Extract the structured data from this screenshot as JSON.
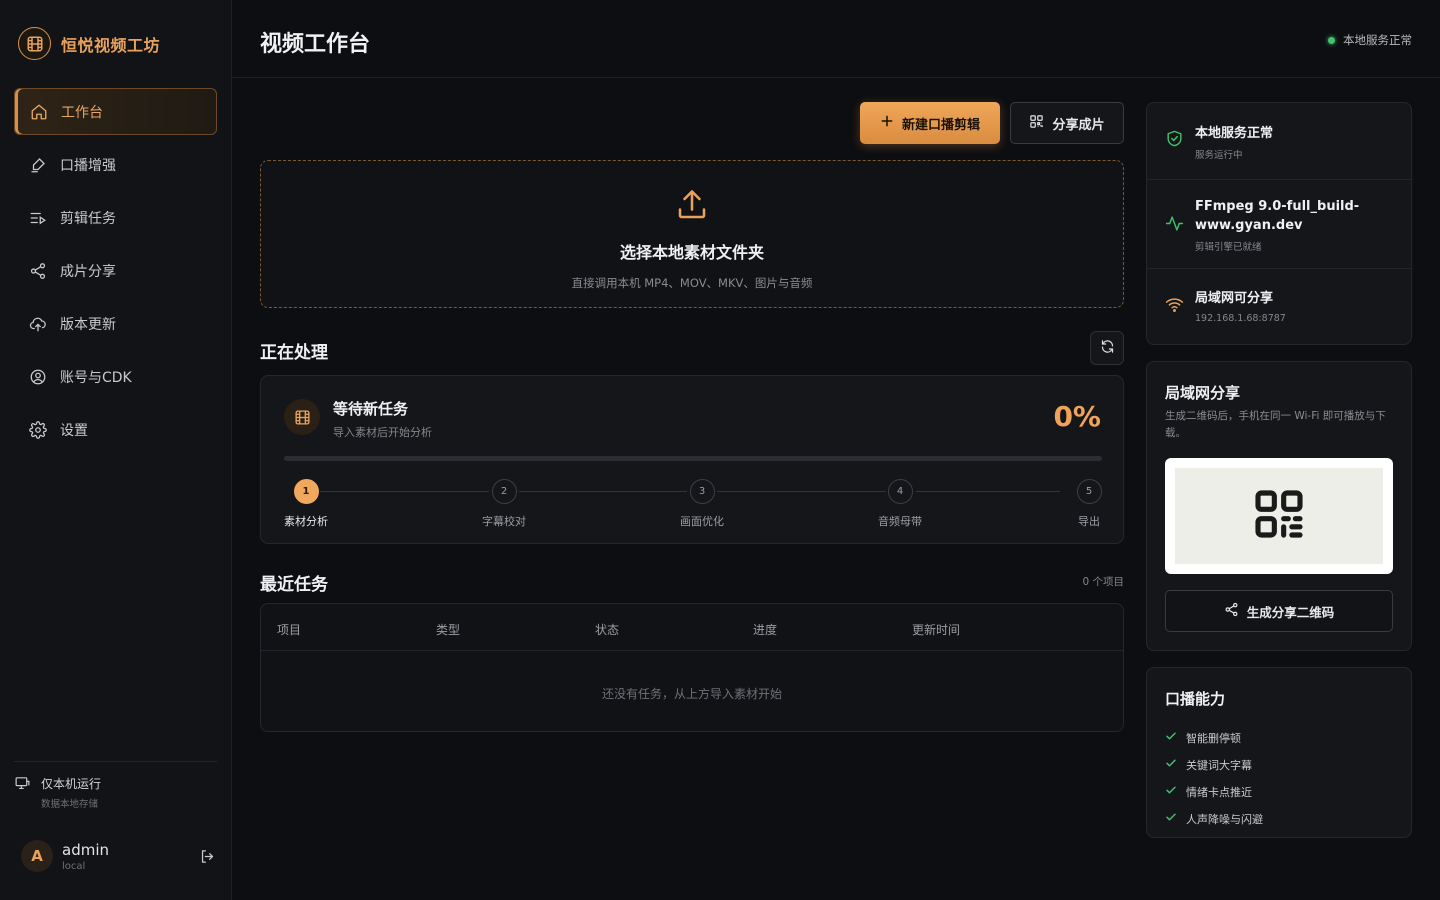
{
  "brand": {
    "name": "恒悦视频工坊"
  },
  "sidebar": {
    "items": [
      {
        "label": "工作台",
        "icon": "home-icon",
        "active": true
      },
      {
        "label": "口播增强",
        "icon": "brush-icon",
        "active": false
      },
      {
        "label": "剪辑任务",
        "icon": "task-list-icon",
        "active": false
      },
      {
        "label": "成片分享",
        "icon": "share-icon",
        "active": false
      },
      {
        "label": "版本更新",
        "icon": "cloud-update-icon",
        "active": false
      },
      {
        "label": "账号与CDK",
        "icon": "user-circle-icon",
        "active": false
      },
      {
        "label": "设置",
        "icon": "gear-icon",
        "active": false
      }
    ],
    "local": {
      "title": "仅本机运行",
      "subtitle": "数据本地存储"
    },
    "user": {
      "avatar": "A",
      "name": "admin",
      "role": "local"
    }
  },
  "header": {
    "title": "视频工作台",
    "status": "本地服务正常"
  },
  "toolbar": {
    "new_label": "新建口播剪辑",
    "share_label": "分享成片"
  },
  "dropzone": {
    "title": "选择本地素材文件夹",
    "subtitle": "直接调用本机 MP4、MOV、MKV、图片与音频"
  },
  "processing": {
    "section_title": "正在处理",
    "task_title": "等待新任务",
    "task_subtitle": "导入素材后开始分析",
    "percent_label": "0%",
    "progress": 0,
    "steps": [
      {
        "num": "1",
        "label": "素材分析",
        "active": true
      },
      {
        "num": "2",
        "label": "字幕校对",
        "active": false
      },
      {
        "num": "3",
        "label": "画面优化",
        "active": false
      },
      {
        "num": "4",
        "label": "音频母带",
        "active": false
      },
      {
        "num": "5",
        "label": "导出",
        "active": false
      }
    ]
  },
  "recent": {
    "section_title": "最近任务",
    "count_label": "0 个项目",
    "columns": [
      "项目",
      "类型",
      "状态",
      "进度",
      "更新时间"
    ],
    "empty_message": "还没有任务，从上方导入素材开始"
  },
  "services": [
    {
      "title": "本地服务正常",
      "subtitle": "服务运行中",
      "icon": "shield-check-icon"
    },
    {
      "title": "FFmpeg 9.0-full_build-www.gyan.dev",
      "subtitle": "剪辑引擎已就绪",
      "icon": "pulse-icon"
    },
    {
      "title": "局域网可分享",
      "subtitle": "192.168.1.68:8787",
      "icon": "wifi-icon"
    }
  ],
  "lan_share": {
    "title": "局域网分享",
    "description": "生成二维码后，手机在同一 Wi-Fi 即可播放与下载。",
    "button_label": "生成分享二维码"
  },
  "capabilities": {
    "title": "口播能力",
    "items": [
      "智能删停顿",
      "关键词大字幕",
      "情绪卡点推近",
      "人声降噪与闪避"
    ]
  },
  "colors": {
    "accent": "#e99c52",
    "success": "#3fc46b",
    "background": "#0d0e11"
  }
}
